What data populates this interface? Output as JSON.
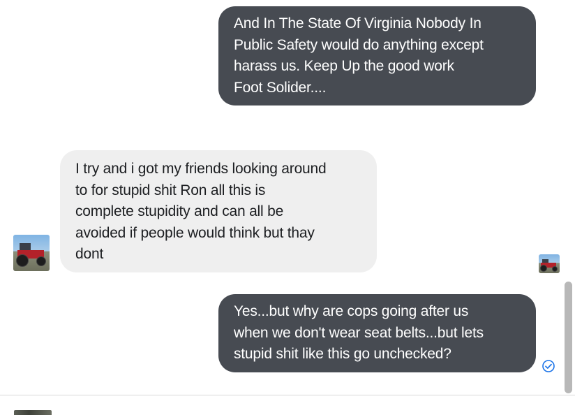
{
  "conversation": {
    "messages": [
      {
        "direction": "outgoing",
        "text": "And In The State Of Virginia Nobody In\nPublic Safety would do anything except\nharass us.  Keep Up the good work\nFoot Solider...."
      },
      {
        "direction": "incoming",
        "text": "I try and i got my friends looking around\nto for stupid shit Ron all this is\ncomplete stupidity and can all be\navoided if people would think but thay\ndont"
      },
      {
        "direction": "outgoing",
        "text": "Yes...but why are cops going after us\nwhen we don't wear seat belts...but lets\nstupid shit like this go unchecked?"
      }
    ],
    "contact_avatar_icon": "tractor-photo-avatar",
    "read_receipt_icon": "tractor-photo-avatar",
    "delivery_status_icon": "sent-check-circle-icon"
  },
  "colors": {
    "outgoing_bubble": "#474b52",
    "incoming_bubble": "#efefef",
    "status_accent": "#1a73e8"
  }
}
